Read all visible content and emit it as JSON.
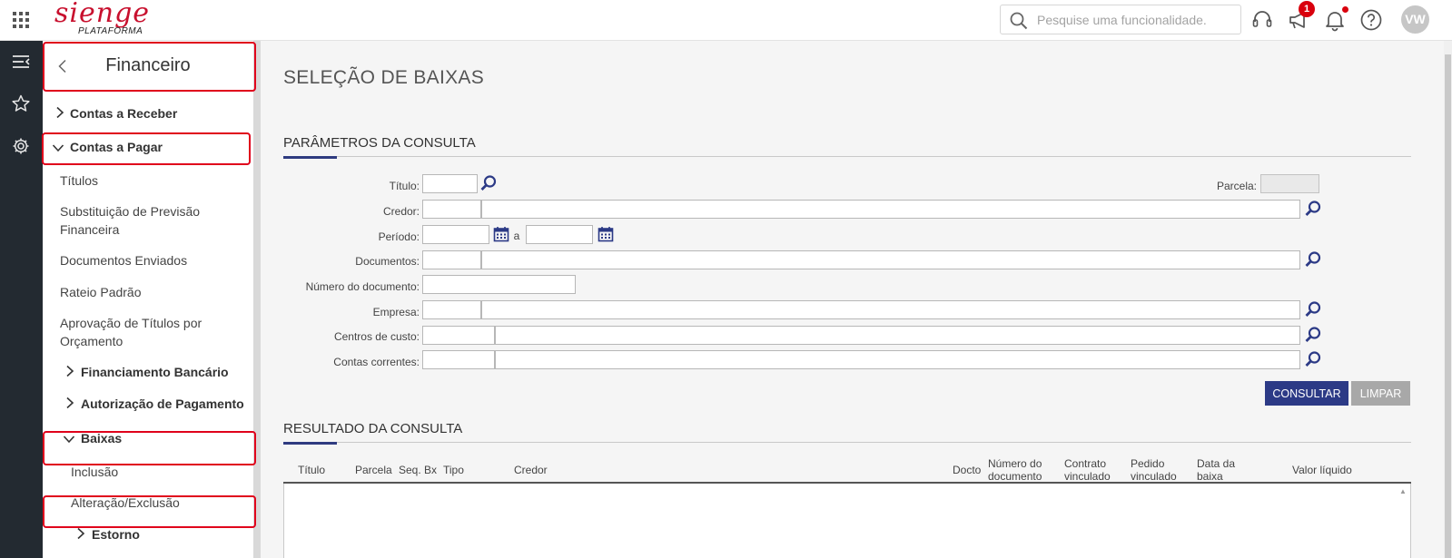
{
  "header": {
    "logo_word": "sienge",
    "logo_sub": "PLATAFORMA",
    "search_placeholder": "Pesquise uma funcionalidade.",
    "notification_count": "1",
    "user_initials": "VW"
  },
  "sidebar": {
    "title": "Financeiro",
    "items": {
      "contas_receber": "Contas a Receber",
      "contas_pagar": "Contas a Pagar",
      "titulos": "Títulos",
      "substituicao": "Substituição de Previsão Financeira",
      "documentos_enviados": "Documentos Enviados",
      "rateio": "Rateio Padrão",
      "aprovacao": "Aprovação de Títulos por Orçamento",
      "financiamento": "Financiamento Bancário",
      "autorizacao": "Autorização de Pagamento",
      "baixas": "Baixas",
      "inclusao": "Inclusão",
      "alteracao": "Alteração/Exclusão",
      "estorno": "Estorno"
    }
  },
  "main": {
    "page_title": "SELEÇÃO DE BAIXAS",
    "params_title": "PARÂMETROS DA CONSULTA",
    "labels": {
      "titulo": "Título:",
      "parcela": "Parcela:",
      "credor": "Credor:",
      "periodo": "Período:",
      "periodo_sep": "a",
      "documentos": "Documentos:",
      "numero_documento": "Número do documento:",
      "empresa": "Empresa:",
      "centros_custo": "Centros de custo:",
      "contas_correntes": "Contas correntes:"
    },
    "buttons": {
      "consultar": "CONSULTAR",
      "limpar": "LIMPAR"
    },
    "result_title": "RESULTADO DA CONSULTA",
    "columns": {
      "titulo": "Título",
      "parcela": "Parcela",
      "seq_bx": "Seq. Bx",
      "tipo": "Tipo",
      "credor": "Credor",
      "docto": "Docto",
      "numero_documento": "Número do documento",
      "contrato": "Contrato vinculado",
      "pedido": "Pedido vinculado",
      "data_baixa": "Data da baixa",
      "valor": "Valor líquido"
    }
  }
}
